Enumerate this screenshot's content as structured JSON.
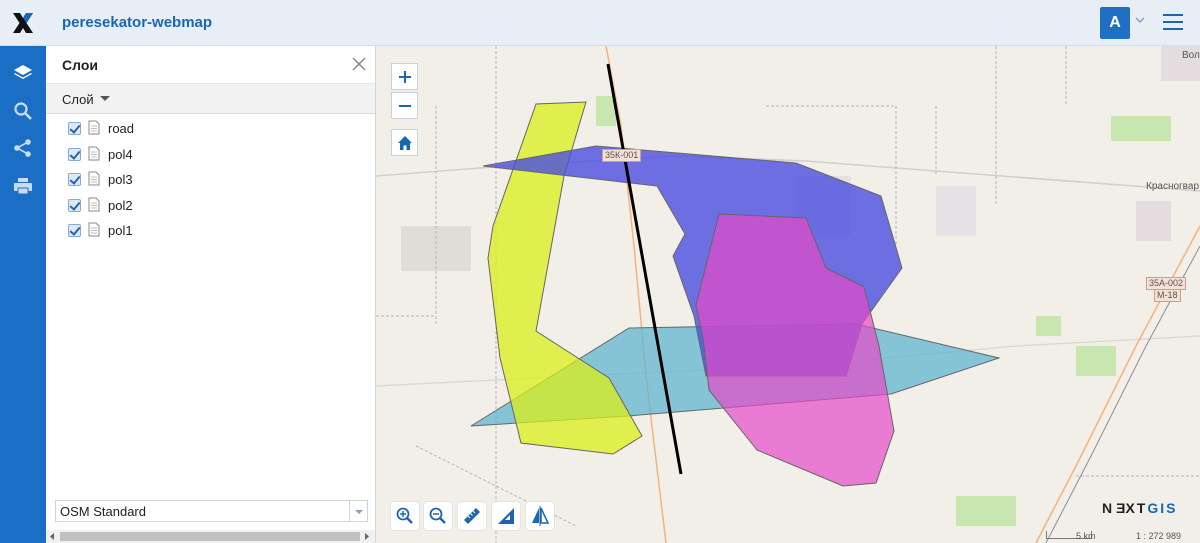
{
  "header": {
    "app_title": "peresekator-webmap",
    "user_initial": "A",
    "logo_icon": "nextgis-x-logo",
    "menu_icon": "hamburger-menu-icon"
  },
  "leftbar": {
    "items": [
      {
        "name": "layers-icon"
      },
      {
        "name": "search-icon"
      },
      {
        "name": "share-icon"
      },
      {
        "name": "print-icon"
      }
    ]
  },
  "panel": {
    "title": "Слои",
    "sub_header": "Слой",
    "layers": [
      {
        "name": "road",
        "checked": true
      },
      {
        "name": "pol4",
        "checked": true
      },
      {
        "name": "pol3",
        "checked": true
      },
      {
        "name": "pol2",
        "checked": true
      },
      {
        "name": "pol1",
        "checked": true
      }
    ],
    "basemap": "OSM Standard"
  },
  "map": {
    "road_labels": [
      "35К-001",
      "35А-002",
      "М-18"
    ],
    "places": [
      "Вол",
      "Красногвар"
    ],
    "brand_prefix": "N",
    "brand_ext": "EXT",
    "brand_gis": "GIS",
    "scale_label": "5 km",
    "scale_ratio": "1 : 272 989",
    "colors": {
      "road": "#000000",
      "pol4": "#4a4ee0",
      "pol3": "#d9ef1a",
      "pol2": "#e64ac8",
      "pol1": "#5fb6cf"
    }
  }
}
